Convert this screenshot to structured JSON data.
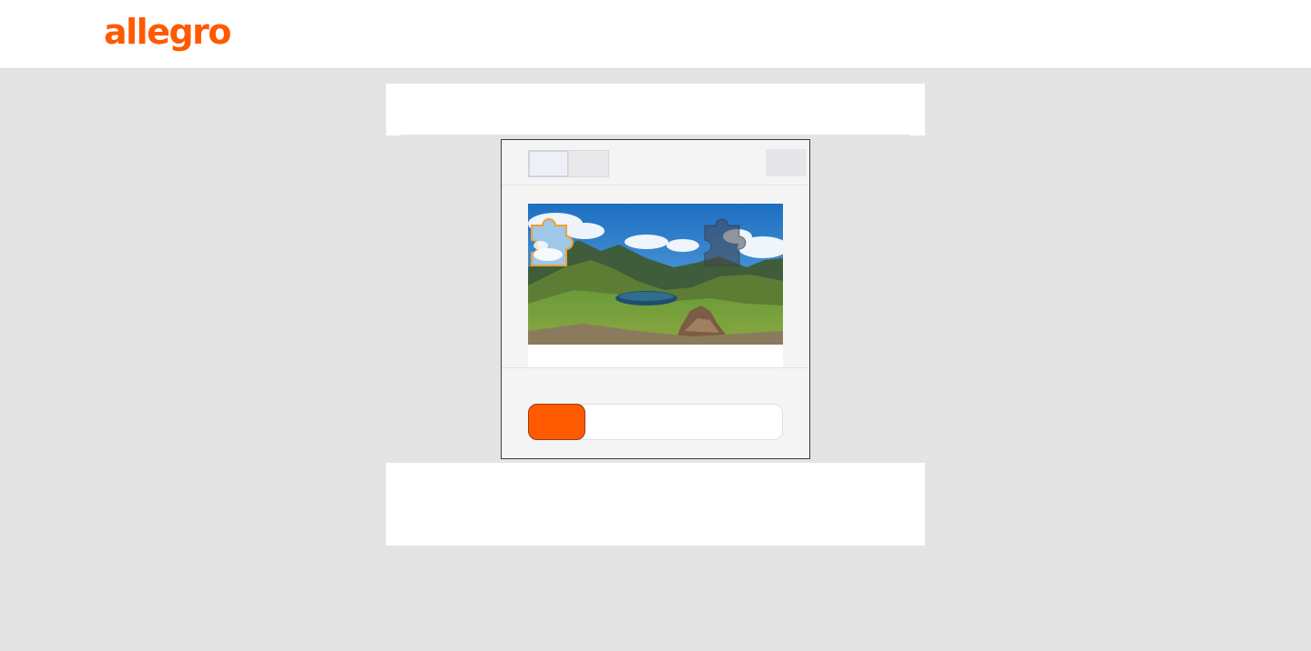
{
  "header": {
    "logo_text": "allegro"
  },
  "captcha": {
    "slider_position": 0,
    "colors": {
      "accent": "#ff5a00",
      "piece_outline": "#f0a030"
    },
    "icons": [
      "puzzle-piece-icon",
      "puzzle-slot-icon"
    ]
  }
}
